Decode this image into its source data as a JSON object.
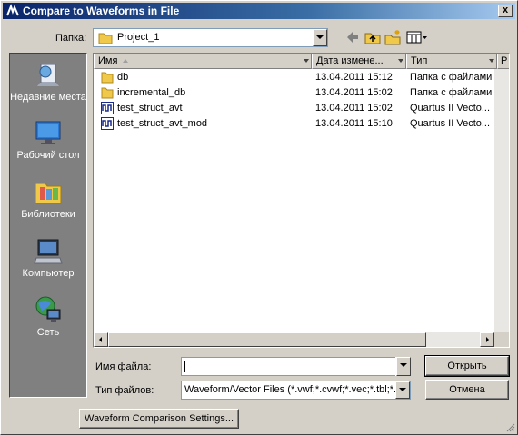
{
  "window": {
    "title": "Compare to Waveforms in File",
    "close_label": "x"
  },
  "lookin": {
    "label": "Папка:",
    "value": "Project_1"
  },
  "toolbar": {
    "icons": [
      "back-icon",
      "up-folder-icon",
      "new-folder-icon",
      "view-menu-icon"
    ]
  },
  "places": [
    {
      "label": "Недавние места",
      "icon": "recent-places-icon"
    },
    {
      "label": "Рабочий стол",
      "icon": "desktop-icon"
    },
    {
      "label": "Библиотеки",
      "icon": "libraries-icon"
    },
    {
      "label": "Компьютер",
      "icon": "computer-icon"
    },
    {
      "label": "Сеть",
      "icon": "network-icon"
    }
  ],
  "columns": [
    "Имя",
    "Дата измене...",
    "Тип",
    "Р"
  ],
  "files": [
    {
      "name": "db",
      "date": "13.04.2011 15:12",
      "type": "Папка с файлами",
      "icon": "folder-icon"
    },
    {
      "name": "incremental_db",
      "date": "13.04.2011 15:02",
      "type": "Папка с файлами",
      "icon": "folder-icon"
    },
    {
      "name": "test_struct_avt",
      "date": "13.04.2011 15:02",
      "type": "Quartus II Vecto...",
      "icon": "waveform-file-icon"
    },
    {
      "name": "test_struct_avt_mod",
      "date": "13.04.2011 15:10",
      "type": "Quartus II Vecto...",
      "icon": "waveform-file-icon"
    }
  ],
  "filename": {
    "label": "Имя файла:",
    "value": ""
  },
  "filetype": {
    "label": "Тип файлов:",
    "value": "Waveform/Vector Files (*.vwf;*.cvwf;*.vec;*.tbl;*."
  },
  "buttons": {
    "open": "Открыть",
    "cancel": "Отмена",
    "settings": "Waveform Comparison Settings..."
  }
}
